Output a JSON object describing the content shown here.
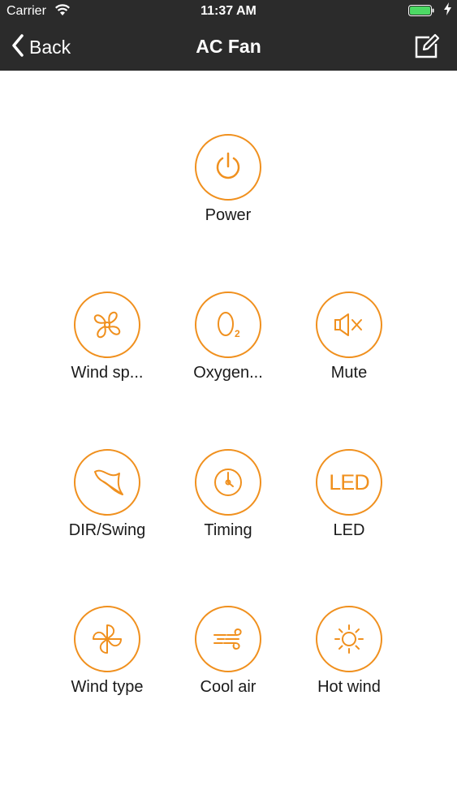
{
  "status_bar": {
    "carrier": "Carrier",
    "time": "11:37 AM"
  },
  "nav": {
    "back_label": "Back",
    "title": "AC Fan"
  },
  "accent_color": "#f0901e",
  "buttons": [
    {
      "label": "Power",
      "icon": "power-icon"
    },
    {
      "label": "Wind sp...",
      "icon": "fan-icon"
    },
    {
      "label": "Oxygen...",
      "icon": "oxygen-icon"
    },
    {
      "label": "Mute",
      "icon": "mute-icon"
    },
    {
      "label": "DIR/Swing",
      "icon": "swing-icon"
    },
    {
      "label": "Timing",
      "icon": "clock-icon"
    },
    {
      "label": "LED",
      "icon": "led-icon",
      "icon_text": "LED"
    },
    {
      "label": "Wind type",
      "icon": "wind-type-icon"
    },
    {
      "label": "Cool air",
      "icon": "cool-air-icon"
    },
    {
      "label": "Hot wind",
      "icon": "sun-icon"
    }
  ]
}
